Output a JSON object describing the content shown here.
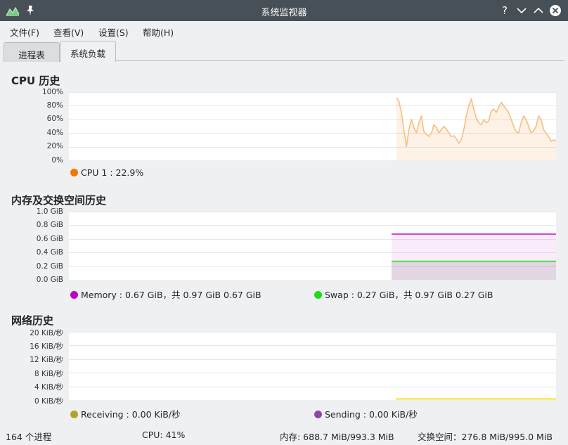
{
  "window": {
    "title": "系统监视器",
    "buttons": [
      "help-icon",
      "minimize-icon",
      "maximize-icon",
      "close-icon"
    ]
  },
  "menu": [
    "文件(F)",
    "查看(V)",
    "设置(S)",
    "帮助(H)"
  ],
  "tabs": [
    {
      "label": "进程表",
      "active": false
    },
    {
      "label": "系统负载",
      "active": true
    }
  ],
  "cpu": {
    "title": "CPU 历史",
    "legend": "CPU 1 : 22.9%",
    "color": "#f67400"
  },
  "memory": {
    "title": "内存及交换空间历史",
    "legend_memory": "Memory : 0.67 GiB，共 0.97 GiB 0.67 GiB",
    "legend_swap": "Swap : 0.27 GiB，共 0.97 GiB 0.27 GiB",
    "memory_color": "#c000c0",
    "swap_color": "#1cdc1c"
  },
  "network": {
    "title": "网络历史",
    "legend_receiving": "Receiving : 0.00 KiB/秒",
    "legend_sending": "Sending : 0.00 KiB/秒",
    "receiving_color": "#b3a32e",
    "sending_color": "#8e44ad"
  },
  "status": {
    "processes": "164 个进程",
    "cpu": "CPU: 41%",
    "memory": "内存: 688.7 MiB/993.3 MiB",
    "swap": "交换空间：276.8 MiB/995.0 MiB"
  },
  "chart_data": [
    {
      "type": "line",
      "title": "CPU 历史",
      "ytick_labels": [
        "100%",
        "80%",
        "60%",
        "40%",
        "20%",
        "0%"
      ],
      "ylim": [
        0,
        100
      ],
      "series": [
        {
          "name": "CPU 1",
          "values": [
            92,
            86,
            70,
            45,
            20,
            45,
            60,
            48,
            40,
            55,
            65,
            42,
            38,
            35,
            40,
            52,
            48,
            40,
            45,
            50,
            46,
            40,
            35,
            36,
            32,
            25,
            30,
            45,
            65,
            80,
            90,
            75,
            62,
            55,
            52,
            60,
            55,
            58,
            72,
            75,
            70,
            78,
            85,
            80,
            75,
            70,
            60,
            50,
            42,
            40,
            55,
            65,
            60,
            50,
            40,
            43,
            50,
            65,
            60,
            45,
            40,
            35,
            28,
            30,
            28
          ]
        }
      ],
      "grid": true
    },
    {
      "type": "area",
      "title": "内存及交换空间历史",
      "ytick_labels": [
        "1.0 GiB",
        "0.8 GiB",
        "0.6 GiB",
        "0.4 GiB",
        "0.2 GiB",
        "0.0 GiB"
      ],
      "ylim": [
        0,
        1.0
      ],
      "series": [
        {
          "name": "Memory",
          "values": [
            0.67,
            0.67,
            0.67,
            0.67,
            0.67,
            0.67,
            0.67,
            0.67
          ]
        },
        {
          "name": "Swap",
          "values": [
            0.27,
            0.27,
            0.27,
            0.27,
            0.27,
            0.27,
            0.27,
            0.27
          ]
        }
      ],
      "grid": true
    },
    {
      "type": "line",
      "title": "网络历史",
      "ytick_labels": [
        "20 KiB/秒",
        "16 KiB/秒",
        "12 KiB/秒",
        "8 KiB/秒",
        "4 KiB/秒",
        "0 KiB/秒"
      ],
      "ylim": [
        0,
        20
      ],
      "series": [
        {
          "name": "Receiving",
          "values": [
            0,
            0,
            0,
            0,
            0,
            0,
            0,
            0
          ]
        },
        {
          "name": "Sending",
          "values": [
            0,
            0,
            0,
            0,
            0,
            0,
            0,
            0
          ]
        }
      ],
      "grid": true
    }
  ]
}
